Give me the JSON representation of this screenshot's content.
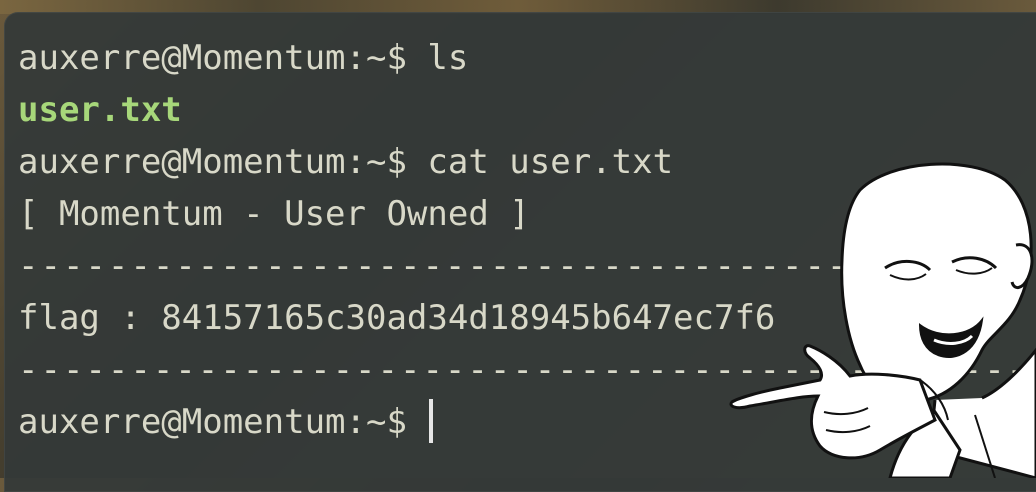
{
  "terminal": {
    "lines": [
      {
        "prompt": "auxerre@Momentum:~$ ",
        "text": "ls"
      },
      {
        "output": "user.txt"
      },
      {
        "prompt": "auxerre@Momentum:~$ ",
        "text": "cat user.txt"
      },
      {
        "output": "[ Momentum - User Owned ]"
      },
      {
        "output": "---------------------------------------------"
      },
      {
        "output": "flag : 84157165c30ad34d18945b647ec7f6"
      },
      {
        "output": "---------------------------------------------"
      },
      {
        "prompt": "auxerre@Momentum:~$ ",
        "text": ""
      }
    ]
  },
  "colors": {
    "terminal_bg": "#343938",
    "text": "#d8d8c8",
    "filename_green": "#a7d77a"
  },
  "overlay": {
    "icon": "pointing-character-icon"
  }
}
